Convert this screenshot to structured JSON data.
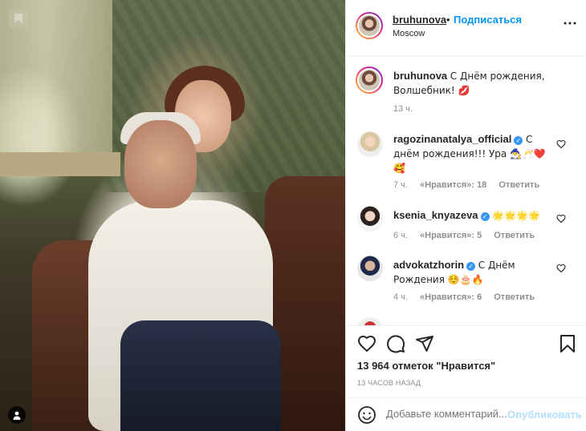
{
  "post": {
    "username": "bruhunova",
    "follow_label": "Подписаться",
    "location": "Moscow",
    "caption_author": "bruhunova",
    "caption_text": "С Днём рождения, Волшебник! 💋",
    "caption_time": "13 ч."
  },
  "comments": [
    {
      "user": "ragozinanatalya_official",
      "text": "С днём рождения!!! Ура 🧙‍♂️🥂❤️ 🥰",
      "time": "7 ч.",
      "likes": "«Нравится»: 18",
      "reply": "Ответить"
    },
    {
      "user": "ksenia_knyazeva",
      "text": "🌟🌟🌟🌟",
      "time": "6 ч.",
      "likes": "«Нравится»: 5",
      "reply": "Ответить"
    },
    {
      "user": "advokatzhorin",
      "text": "С Днём Рождения ☺️🎂🔥",
      "time": "4 ч.",
      "likes": "«Нравится»: 6",
      "reply": "Ответить"
    }
  ],
  "stats": {
    "likes_count": "13 964",
    "likes_suffix": "отметок \"Нравится\"",
    "time_ago": "13 ЧАСОВ НАЗАД"
  },
  "add_comment": {
    "placeholder": "Добавьте комментарий...",
    "post_label": "Опубликовать"
  },
  "colors": {
    "accent": "#0095f6",
    "verified": "#3897f0",
    "muted": "#8e8e8e",
    "post_disabled": "#b2dffc"
  }
}
